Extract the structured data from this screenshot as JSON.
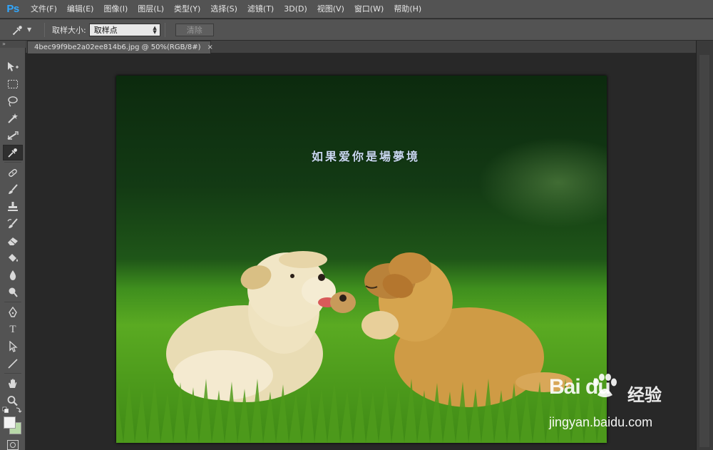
{
  "app": {
    "logo": "Ps"
  },
  "menu": [
    {
      "label": "文件(F)"
    },
    {
      "label": "编辑(E)"
    },
    {
      "label": "图像(I)"
    },
    {
      "label": "图层(L)"
    },
    {
      "label": "类型(Y)"
    },
    {
      "label": "选择(S)"
    },
    {
      "label": "滤镜(T)"
    },
    {
      "label": "3D(D)"
    },
    {
      "label": "视图(V)"
    },
    {
      "label": "窗口(W)"
    },
    {
      "label": "帮助(H)"
    }
  ],
  "options": {
    "sample_size_label": "取样大小:",
    "sample_size_value": "取样点",
    "clear_label": "清除"
  },
  "document": {
    "tab_title": "4bec99f9be2a02ee814b6.jpg @ 50%(RGB/8#)",
    "close_glyph": "×",
    "caption": "如果爱你是場夢境"
  },
  "toolbar": {
    "grip": "»",
    "tools": [
      {
        "name": "move-tool-icon"
      },
      {
        "name": "marquee-tool-icon"
      },
      {
        "name": "lasso-tool-icon"
      },
      {
        "name": "magic-wand-tool-icon"
      },
      {
        "name": "crop-tool-icon"
      },
      {
        "name": "eyedropper-tool-icon",
        "active": true
      },
      {
        "name": "healing-brush-tool-icon"
      },
      {
        "name": "brush-tool-icon"
      },
      {
        "name": "clone-stamp-tool-icon"
      },
      {
        "name": "history-brush-tool-icon"
      },
      {
        "name": "eraser-tool-icon"
      },
      {
        "name": "paint-bucket-tool-icon"
      },
      {
        "name": "blur-tool-icon"
      },
      {
        "name": "dodge-tool-icon"
      },
      {
        "name": "pen-tool-icon"
      },
      {
        "name": "type-tool-icon",
        "text": "T"
      },
      {
        "name": "path-selection-tool-icon"
      },
      {
        "name": "line-tool-icon"
      },
      {
        "name": "hand-tool-icon"
      },
      {
        "name": "zoom-tool-icon"
      }
    ]
  },
  "watermark": {
    "brand": "Bai du",
    "brand_cn": "经验",
    "url": "jingyan.baidu.com"
  }
}
